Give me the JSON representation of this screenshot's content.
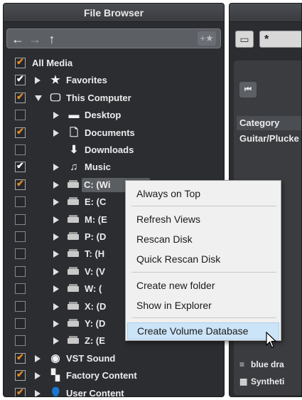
{
  "file_browser": {
    "title": "File Browser",
    "nav": {
      "back": "←",
      "forward": "→",
      "up": "↑",
      "favorite": "+★"
    },
    "tree": [
      {
        "label": "All Media",
        "check": "orange",
        "indent": 0,
        "arrow": "none",
        "icon": "none"
      },
      {
        "label": "Favorites",
        "check": "white",
        "indent": 1,
        "arrow": "right",
        "icon": "star-icon"
      },
      {
        "label": "This Computer",
        "check": "orange",
        "indent": 1,
        "arrow": "down",
        "icon": "monitor-icon"
      },
      {
        "label": "Desktop",
        "check": "none",
        "indent": 2,
        "arrow": "right",
        "icon": "desktop-icon"
      },
      {
        "label": "Documents",
        "check": "orange",
        "indent": 2,
        "arrow": "right",
        "icon": "document-icon"
      },
      {
        "label": "Downloads",
        "check": "none",
        "indent": 2,
        "arrow": "none",
        "icon": "download-icon"
      },
      {
        "label": "Music",
        "check": "white",
        "indent": 2,
        "arrow": "right",
        "icon": "music-note-icon"
      },
      {
        "label": "C: (Wi",
        "check": "orange",
        "indent": 2,
        "arrow": "right",
        "icon": "drive-icon",
        "selected": true
      },
      {
        "label": "E: (C",
        "check": "none",
        "indent": 2,
        "arrow": "right",
        "icon": "drive-icon"
      },
      {
        "label": "M: (E",
        "check": "none",
        "indent": 2,
        "arrow": "right",
        "icon": "drive-icon"
      },
      {
        "label": "P: (D",
        "check": "none",
        "indent": 2,
        "arrow": "right",
        "icon": "drive-icon"
      },
      {
        "label": "T: (H",
        "check": "none",
        "indent": 2,
        "arrow": "right",
        "icon": "drive-icon"
      },
      {
        "label": "V: (V",
        "check": "none",
        "indent": 2,
        "arrow": "right",
        "icon": "drive-icon"
      },
      {
        "label": "W: (",
        "check": "none",
        "indent": 2,
        "arrow": "right",
        "icon": "drive-icon"
      },
      {
        "label": "X: (D",
        "check": "none",
        "indent": 2,
        "arrow": "right",
        "icon": "drive-icon"
      },
      {
        "label": "Y: (D",
        "check": "none",
        "indent": 2,
        "arrow": "right",
        "icon": "drive-icon"
      },
      {
        "label": "Z: (E",
        "check": "none",
        "indent": 2,
        "arrow": "right",
        "icon": "drive-icon"
      },
      {
        "label": "VST Sound",
        "check": "orange",
        "indent": 1,
        "arrow": "right",
        "icon": "vst-disc-icon"
      },
      {
        "label": "Factory Content",
        "check": "orange",
        "indent": 1,
        "arrow": "right",
        "icon": "factory-grid-icon"
      },
      {
        "label": "User Content",
        "check": "orange",
        "indent": 1,
        "arrow": "right",
        "icon": "user-icon"
      }
    ]
  },
  "right_panel": {
    "search_value": "*",
    "skip_back": "⏮",
    "category_header": "Category",
    "category_value": "Guitar/Plucke",
    "results": [
      {
        "icon": "list-icon",
        "label": "blue dra"
      },
      {
        "icon": "synth-icon",
        "label": "Syntheti"
      }
    ]
  },
  "context_menu": {
    "items": [
      {
        "label": "Always on Top"
      },
      {
        "label": "Refresh Views"
      },
      {
        "label": "Rescan Disk"
      },
      {
        "label": "Quick Rescan Disk"
      },
      {
        "label": "Create new folder"
      },
      {
        "label": "Show in Explorer"
      },
      {
        "label": "Create Volume Database",
        "highlighted": true
      }
    ]
  }
}
